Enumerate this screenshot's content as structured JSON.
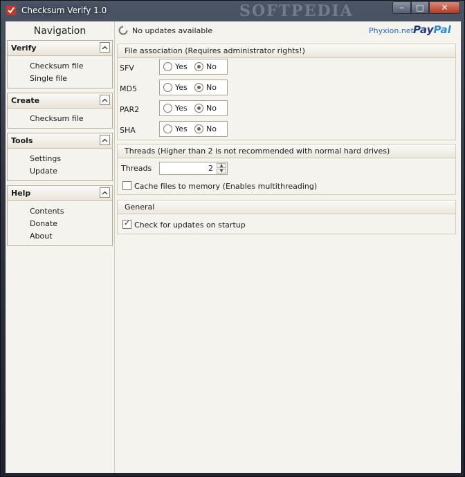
{
  "window": {
    "title": "Checksum Verify 1.0",
    "watermark": "SOFTPEDIA",
    "controls": {
      "minimize": "–",
      "maximize": "□",
      "close": "✕"
    }
  },
  "sidebar": {
    "title": "Navigation",
    "groups": [
      {
        "label": "Verify",
        "items": [
          "Checksum file",
          "Single file"
        ]
      },
      {
        "label": "Create",
        "items": [
          "Checksum file"
        ]
      },
      {
        "label": "Tools",
        "items": [
          "Settings",
          "Update"
        ]
      },
      {
        "label": "Help",
        "items": [
          "Contents",
          "Donate",
          "About"
        ]
      }
    ]
  },
  "topbar": {
    "status": "No updates available",
    "link": "Phyxion.net",
    "paypal_a": "Pay",
    "paypal_b": "Pal"
  },
  "file_association": {
    "title": "File association (Requires administrator rights!)",
    "rows": [
      {
        "label": "SFV",
        "yes": "Yes",
        "no": "No",
        "selected": "No"
      },
      {
        "label": "MD5",
        "yes": "Yes",
        "no": "No",
        "selected": "No"
      },
      {
        "label": "PAR2",
        "yes": "Yes",
        "no": "No",
        "selected": "No"
      },
      {
        "label": "SHA",
        "yes": "Yes",
        "no": "No",
        "selected": "No"
      }
    ]
  },
  "threads": {
    "title": "Threads (Higher than 2 is not recommended with normal hard drives)",
    "label": "Threads",
    "value": "2",
    "cache_label": "Cache files to memory (Enables multithreading)",
    "cache_checked": false
  },
  "general": {
    "title": "General",
    "updates_label": "Check for updates on startup",
    "updates_checked": true
  },
  "colors": {
    "accent_link": "#2b63c9",
    "paypal_dark": "#1f3a78",
    "paypal_light": "#2c8ad6"
  }
}
